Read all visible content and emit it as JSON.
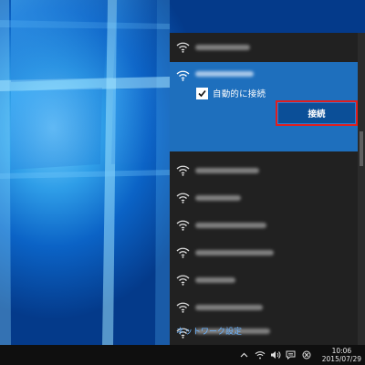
{
  "flyout": {
    "networks": [
      {
        "ssid_blurred": true,
        "selected": false
      },
      {
        "ssid_blurred": true,
        "selected": true
      },
      {
        "ssid_blurred": true,
        "selected": false
      },
      {
        "ssid_blurred": true,
        "selected": false
      },
      {
        "ssid_blurred": true,
        "selected": false
      },
      {
        "ssid_blurred": true,
        "selected": false
      },
      {
        "ssid_blurred": true,
        "selected": false
      },
      {
        "ssid_blurred": true,
        "selected": false
      },
      {
        "ssid_blurred": true,
        "selected": false
      }
    ],
    "auto_connect_label": "自動的に接続",
    "auto_connect_checked": true,
    "connect_button_label": "接続",
    "highlight_color": "#e01e1e",
    "selected_bg": "#1e6fbd",
    "settings_link": "ネットワーク設定"
  },
  "taskbar": {
    "tray_icons": [
      "chevron-up-icon",
      "wifi-icon",
      "volume-icon",
      "action-center-icon",
      "input-indicator-icon"
    ],
    "time": "10:06",
    "date": "2015/07/29"
  }
}
